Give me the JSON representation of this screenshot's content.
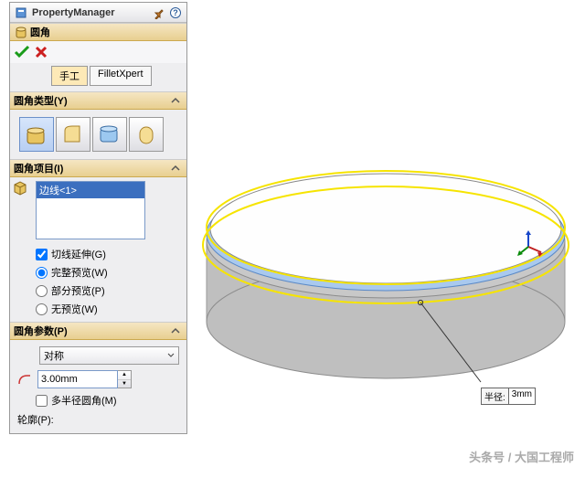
{
  "header": {
    "title": "PropertyManager"
  },
  "feature": {
    "title": "圆角"
  },
  "tabs": {
    "manual": "手工",
    "filletxpert": "FilletXpert"
  },
  "sections": {
    "type": {
      "title": "圆角类型(Y)"
    },
    "items": {
      "title": "圆角项目(I)",
      "selected_edge": "边线<1>",
      "tangent_prop": "切线延伸(G)",
      "full_preview": "完整预览(W)",
      "partial_preview": "部分预览(P)",
      "no_preview": "无预览(W)"
    },
    "params": {
      "title": "圆角参数(P)",
      "symmetry": "对称",
      "radius_value": "3.00mm",
      "multi_radius": "多半径圆角(M)",
      "profile": "轮廓(P):"
    }
  },
  "callout": {
    "label": "半径:",
    "value": "3mm"
  },
  "watermark": "头条号 / 大国工程师"
}
